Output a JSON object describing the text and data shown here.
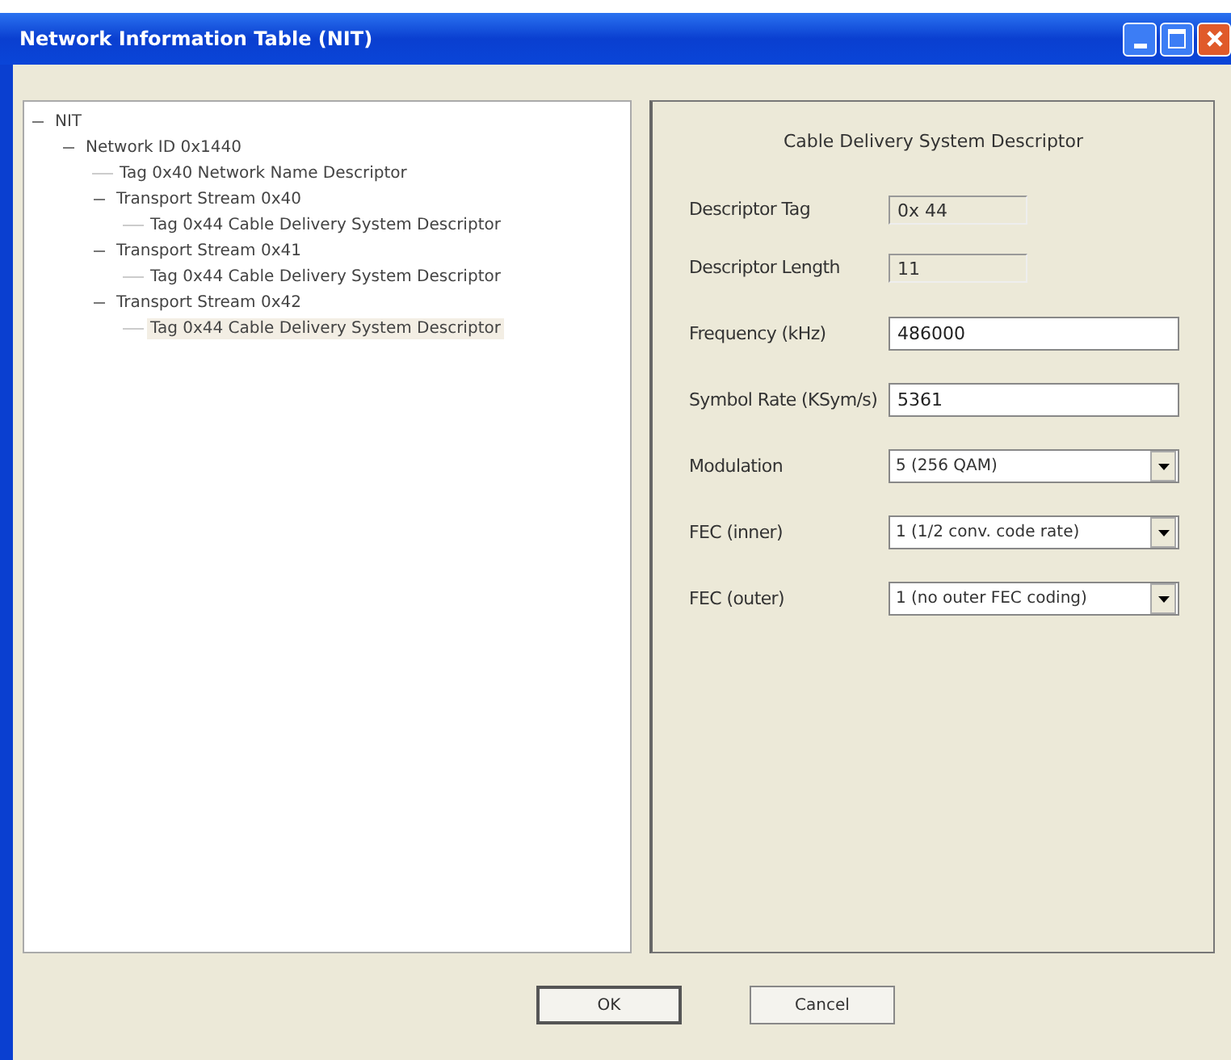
{
  "window": {
    "title": "Network Information Table (NIT)"
  },
  "tree": [
    {
      "label": "NIT",
      "expanded": true,
      "selected": false,
      "children": [
        {
          "label": "Network ID 0x1440",
          "expanded": true,
          "selected": false,
          "children": [
            {
              "label": "Tag 0x40 Network Name Descriptor",
              "selected": false
            },
            {
              "label": "Transport Stream 0x40",
              "expanded": true,
              "selected": false,
              "children": [
                {
                  "label": "Tag 0x44 Cable Delivery System Descriptor",
                  "selected": false
                }
              ]
            },
            {
              "label": "Transport Stream 0x41",
              "expanded": true,
              "selected": false,
              "children": [
                {
                  "label": "Tag 0x44 Cable Delivery System Descriptor",
                  "selected": false
                }
              ]
            },
            {
              "label": "Transport Stream 0x42",
              "expanded": true,
              "selected": false,
              "children": [
                {
                  "label": "Tag 0x44 Cable Delivery System Descriptor",
                  "selected": true
                }
              ]
            }
          ]
        }
      ]
    }
  ],
  "panel": {
    "title": "Cable Delivery System Descriptor",
    "fields": [
      {
        "kind": "readonly",
        "label": "Descriptor Tag",
        "value": "0x 44"
      },
      {
        "kind": "readonly",
        "label": "Descriptor Length",
        "value": "11"
      },
      {
        "kind": "text",
        "label": "Frequency (kHz)",
        "value": "486000"
      },
      {
        "kind": "text",
        "label": "Symbol Rate (KSym/s)",
        "value": "5361"
      },
      {
        "kind": "select",
        "label": "Modulation",
        "value": "5 (256 QAM)"
      },
      {
        "kind": "select",
        "label": "FEC (inner)",
        "value": "1 (1/2 conv. code rate)"
      },
      {
        "kind": "select",
        "label": "FEC (outer)",
        "value": "1 (no outer FEC coding)"
      }
    ]
  },
  "buttons": [
    {
      "label": "OK",
      "default": true
    },
    {
      "label": "Cancel",
      "default": false
    }
  ]
}
